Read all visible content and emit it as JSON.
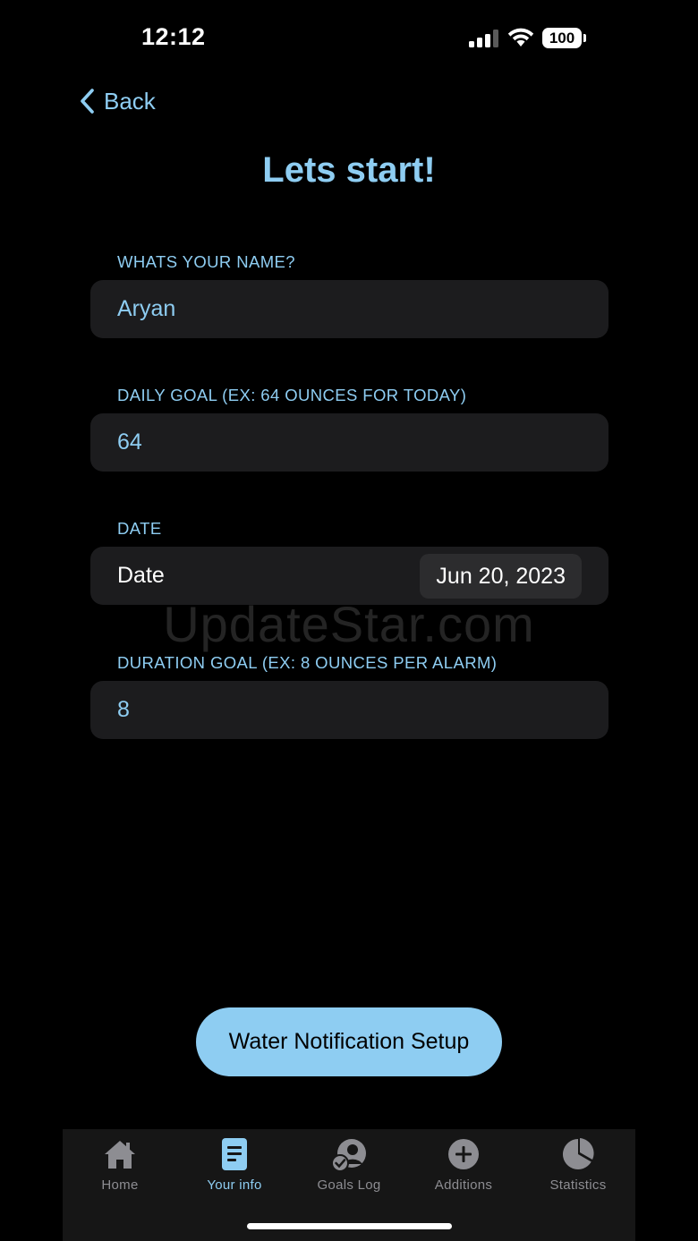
{
  "status_bar": {
    "time": "12:12",
    "battery": "100"
  },
  "nav": {
    "back_label": "Back"
  },
  "page": {
    "title": "Lets start!"
  },
  "form": {
    "name": {
      "label": "WHATS YOUR NAME?",
      "value": "Aryan"
    },
    "daily_goal": {
      "label": "DAILY GOAL (EX: 64 OUNCES FOR TODAY)",
      "value": "64"
    },
    "date": {
      "label": "DATE",
      "row_label": "Date",
      "value": "Jun 20, 2023"
    },
    "duration_goal": {
      "label": "DURATION GOAL (EX: 8 OUNCES PER ALARM)",
      "value": "8"
    }
  },
  "watermark": "UpdateStar.com",
  "cta": {
    "label": "Water Notification Setup"
  },
  "tabbar": {
    "items": [
      {
        "label": "Home",
        "icon": "house-icon"
      },
      {
        "label": "Your info",
        "icon": "document-icon",
        "active": true
      },
      {
        "label": "Goals Log",
        "icon": "person-check-icon"
      },
      {
        "label": "Additions",
        "icon": "plus-circle-icon"
      },
      {
        "label": "Statistics",
        "icon": "pie-chart-icon"
      }
    ]
  },
  "colors": {
    "accent": "#8ecdf2",
    "field_bg": "#1c1c1e",
    "inactive_tab": "#8d8d92",
    "background": "#000000"
  }
}
